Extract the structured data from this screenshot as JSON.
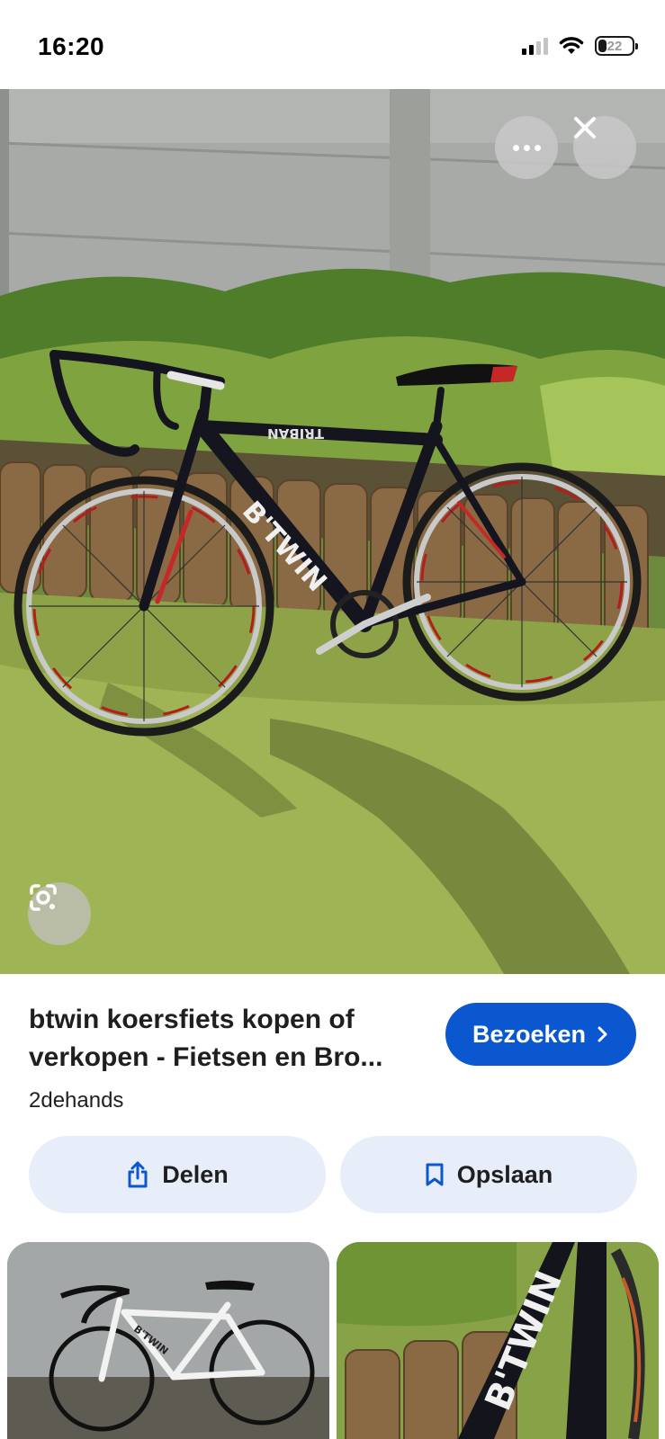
{
  "status_bar": {
    "time": "16:20",
    "battery": "22",
    "icons": [
      "signal-icon",
      "wifi-icon",
      "battery-icon"
    ]
  },
  "image_viewer": {
    "more_button_icon": "more-horizontal-icon",
    "close_button_icon": "close-icon",
    "lens_button_icon": "google-lens-icon",
    "frame_text": "B'TWIN",
    "top_tube_text": "TRIBAN"
  },
  "result": {
    "title": "btwin koersfiets kopen of verkopen - Fietsen en Bro...",
    "source": "2dehands",
    "visit_label": "Bezoeken",
    "visit_icon": "chevron-right-icon",
    "share_label": "Delen",
    "share_icon": "share-icon",
    "save_label": "Opslaan",
    "save_icon": "bookmark-icon"
  },
  "related_images": [
    {
      "frame_text": "B'TWIN"
    },
    {
      "frame_text": "B'TWIN"
    }
  ],
  "colors": {
    "accent": "#0b57d0",
    "pill_background": "#e8eef9",
    "overlay_button": "#c8c8c8"
  }
}
